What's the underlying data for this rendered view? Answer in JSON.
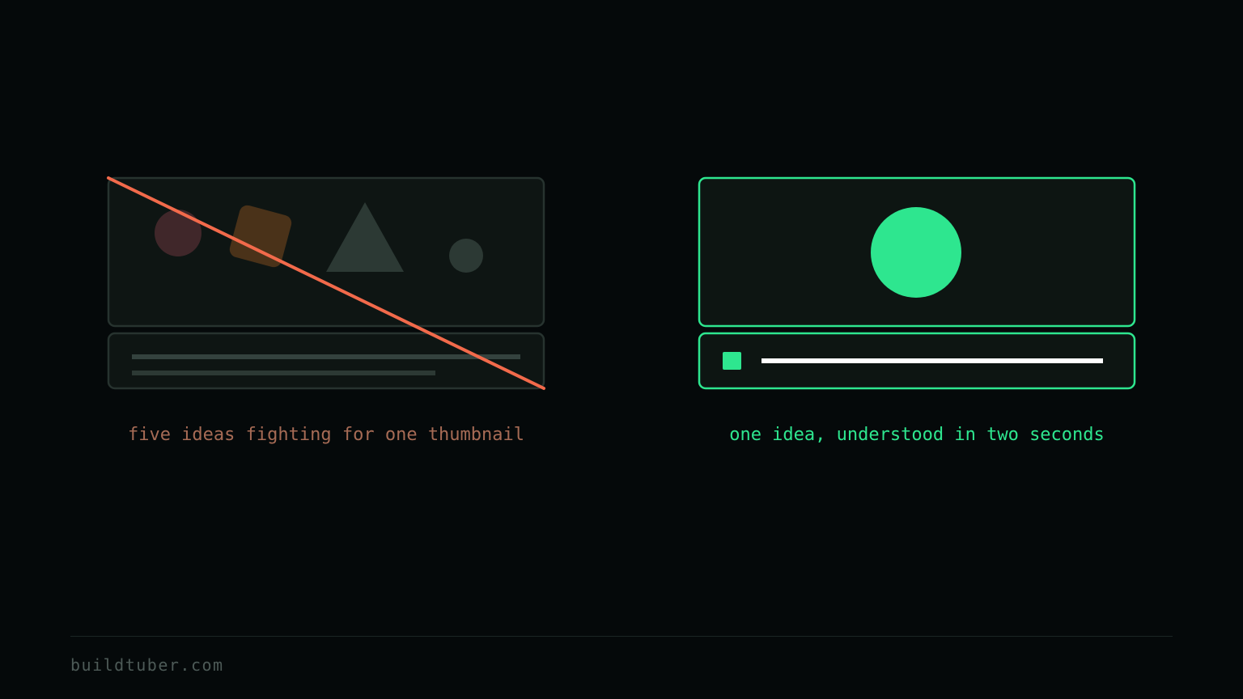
{
  "bad_example": {
    "caption": "five ideas fighting for one thumbnail",
    "colors": {
      "caption": "#a66b55",
      "strike": "#f26a4b",
      "frame_stroke": "#27332f",
      "frame_fill": "#0e1513",
      "shapes": [
        "#40272a",
        "#4a3219",
        "#2c3934"
      ]
    },
    "icons": [
      "circle-icon",
      "rounded-square-icon",
      "triangle-icon",
      "small-circle-icon",
      "strike-line-icon"
    ]
  },
  "good_example": {
    "caption": "one idea, understood in two seconds",
    "colors": {
      "caption": "#2ee68f",
      "accent": "#2ee68f",
      "title_bar": "#ffffff",
      "frame_fill": "#0d1512"
    },
    "icons": [
      "focus-circle-icon",
      "square-bullet-icon"
    ]
  },
  "footer": {
    "site": "buildtuber.com"
  }
}
